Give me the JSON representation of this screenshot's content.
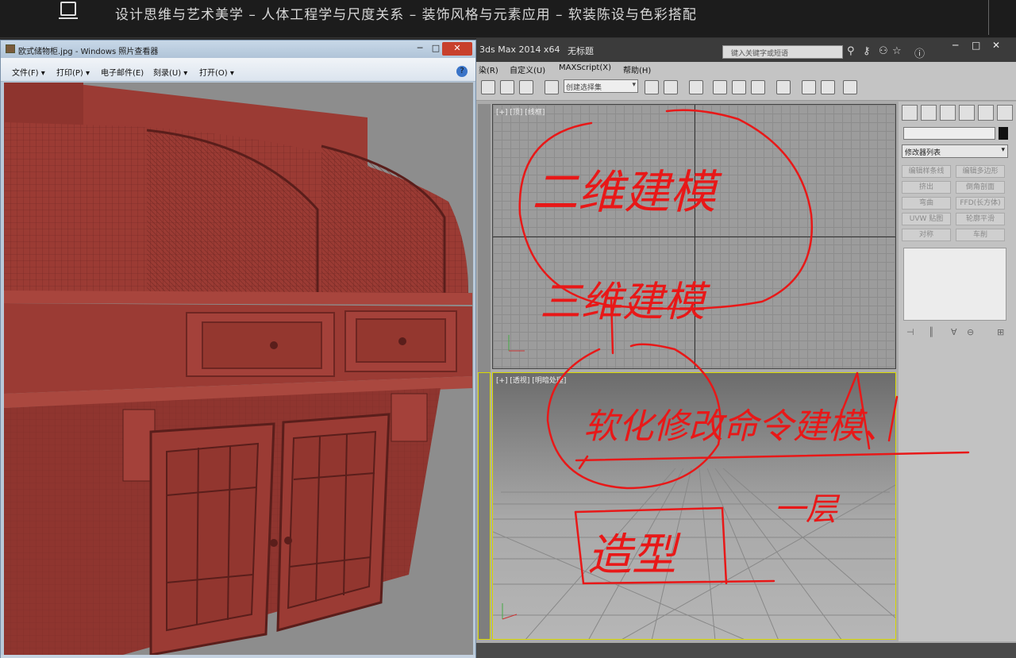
{
  "banner": {
    "title": "设计思维与艺术美学 – 人体工程学与尺度关系 – 装饰风格与元素应用 – 软装陈设与色彩搭配"
  },
  "photo_viewer": {
    "title": "欧式储物柜.jpg - Windows 照片查看器",
    "menu": [
      "文件(F) ▾",
      "打印(P) ▾",
      "电子邮件(E)",
      "刻录(U) ▾",
      "打开(O) ▾"
    ],
    "controls": {
      "minimize": "─",
      "maximize": "□",
      "close": "✕"
    },
    "help": "?"
  },
  "max": {
    "title": "3ds Max  2014 x64",
    "doc": "无标题",
    "search_placeholder": "键入关键字或短语",
    "menu": [
      "染(R)",
      "自定义(U)",
      "MAXScript(X)",
      "帮助(H)"
    ],
    "selection_set_placeholder": "创建选择集",
    "viewport_top_label": "[+] [顶] [线框]",
    "viewport_persp_label": "[+] [透视] [明暗处理]",
    "command_panel": {
      "modifier_list": "修改器列表",
      "buttons": [
        "编辑样条线",
        "编辑多边形",
        "挤出",
        "倒角剖面",
        "弯曲",
        "FFD(长方体)",
        "UVW 贴图",
        "轮廓平滑",
        "对称",
        "车削"
      ]
    }
  },
  "handwriting": {
    "line1": "二维建模",
    "line2": "三维建模",
    "line3": "软化修改命令建模、",
    "line4": "造型",
    "line5": "一层"
  },
  "colors": {
    "ink": "#e81818",
    "cabinet": "#9b3b34",
    "cabinet_dark": "#6e2622",
    "viewer_chrome": "#b9c9d9"
  }
}
